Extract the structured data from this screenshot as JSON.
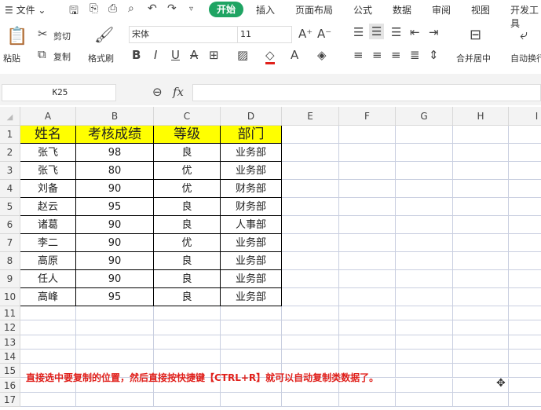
{
  "menubar": {
    "file": "文件",
    "tabs": [
      "开始",
      "插入",
      "页面布局",
      "公式",
      "数据",
      "审阅",
      "视图",
      "开发工具"
    ]
  },
  "ribbon": {
    "paste": "粘贴",
    "cut": "剪切",
    "copy": "复制",
    "format_painter": "格式刷",
    "font": "宋体",
    "font_size": "11",
    "merge_center": "合并居中",
    "wrap": "自动换行"
  },
  "formula_bar": {
    "cell_ref": "K25",
    "fx": "fx",
    "value": ""
  },
  "sheet": {
    "columns": [
      "A",
      "B",
      "C",
      "D",
      "E",
      "F",
      "G",
      "H",
      "I"
    ],
    "headers": [
      "姓名",
      "考核成绩",
      "等级",
      "部门"
    ],
    "rows": [
      [
        "张飞",
        "98",
        "良",
        "业务部"
      ],
      [
        "张飞",
        "80",
        "优",
        "业务部"
      ],
      [
        "刘备",
        "90",
        "优",
        "财务部"
      ],
      [
        "赵云",
        "95",
        "良",
        "财务部"
      ],
      [
        "诸葛",
        "90",
        "良",
        "人事部"
      ],
      [
        "李二",
        "90",
        "优",
        "业务部"
      ],
      [
        "高原",
        "90",
        "良",
        "业务部"
      ],
      [
        "任人",
        "90",
        "良",
        "业务部"
      ],
      [
        "高峰",
        "95",
        "良",
        "业务部"
      ]
    ],
    "row_numbers": [
      "1",
      "2",
      "3",
      "4",
      "5",
      "6",
      "7",
      "8",
      "9",
      "10",
      "11",
      "12",
      "13",
      "14",
      "15",
      "16",
      "17"
    ]
  },
  "note": "直接选中要复制的位置，然后直接按快捷键【CTRL+R】就可以自动复制类数据了。",
  "colors": {
    "accent": "#1fa463",
    "header_fill": "#ffff00",
    "note": "#e0201b"
  }
}
